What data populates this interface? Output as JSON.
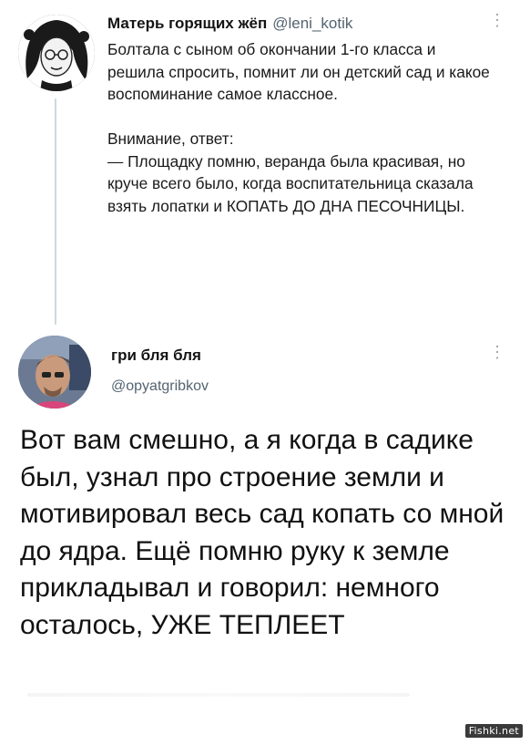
{
  "tweet1": {
    "display_name": "Матерь горящих жёп",
    "handle": "@leni_kotik",
    "text": "Болтала с сыном об окончании 1-го класса и решила спросить, помнит ли он детский сад и какое воспоминание самое классное.\n\nВнимание, ответ:\n— Площадку помню, веранда была красивая, но круче всего было, когда воспитательница сказала взять лопатки и КОПАТЬ ДО ДНА ПЕСОЧНИЦЫ."
  },
  "tweet2": {
    "display_name": "гри бля бля",
    "handle": "@opyatgribkov",
    "text": "Вот вам смешно, а я когда в садике был, узнал про строение земли и мотивировал весь сад копать со мной до ядра. Ещё помню руку к земле прикладывал и говорил: немного осталось, УЖЕ ТЕПЛЕЕТ"
  },
  "icons": {
    "more": "vertical-ellipsis-icon"
  },
  "watermark": "Fishki.net"
}
